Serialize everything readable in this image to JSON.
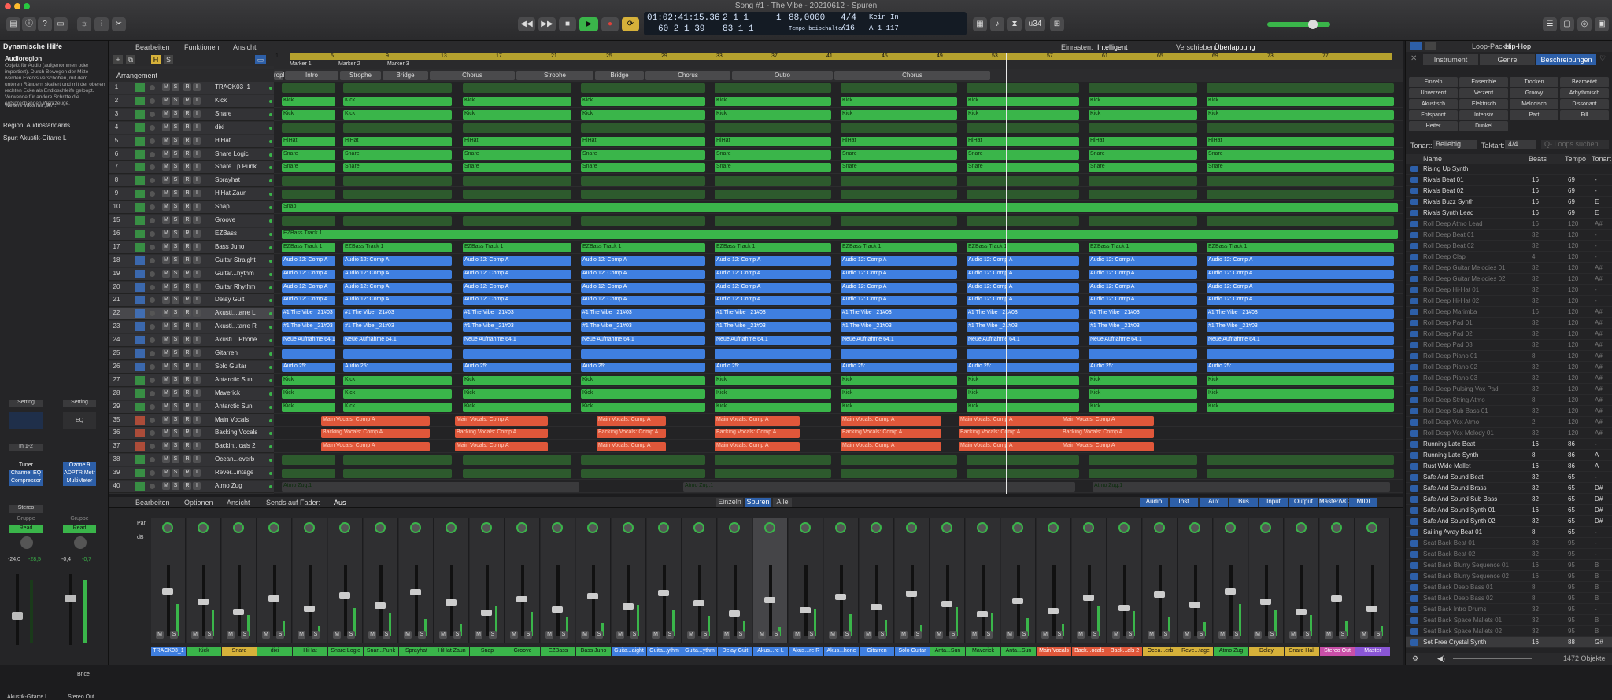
{
  "window": {
    "title": "Song #1 - The Vibe - 20210612 - Spuren"
  },
  "lcd": {
    "position": "01:02:41:15.36",
    "bars": "2  1  1",
    "subpos": "60  2  1  39",
    "bars2": "83  1  1",
    "beat": "1",
    "tempo": "88,0000",
    "tempo_label": "Tempo beibehalten",
    "sig": "4/4",
    "sig2": "/16",
    "key_in": "Kein In",
    "key_out": "A  1  117"
  },
  "toolbar": {
    "cpu_label": "u34"
  },
  "inspector": {
    "help_title": "Dynamische Hilfe",
    "help_heading": "Audioregion",
    "help_text": "Objekt für Audio (aufgenommen oder importiert). Durch Bewegen der Mitte werden Events verschoben, mit dem unteren Rändern skaliert und mit der oberen rechten Ecke als Endloschleife geloopt. Verwende für andere Schritte die entsprechenden Werkzeuge.",
    "help_more": "Weitere Infos mit „⌘/\".",
    "region_label": "Region: Audiostandards",
    "track_label": "Spur: Akustik-Gitarre L",
    "strip1": {
      "setting": "Setting",
      "input": "In 1-2",
      "plugins": [
        "Tuner",
        "Channel EQ",
        "Compressor"
      ],
      "stereo": "Stereo",
      "group": "Gruppe",
      "read": "Read",
      "gain": "-24,0",
      "peak": "-28,5",
      "name": "Akustik-Gitarre L"
    },
    "strip2": {
      "setting": "Setting",
      "eq": "EQ",
      "plugins": [
        "Ozone 9",
        "ADPTR Metr",
        "MultiMeter"
      ],
      "group": "Gruppe",
      "read": "Read",
      "gain": "-0,4",
      "peak": "-0,7",
      "name": "Stereo Out",
      "bnce": "Bnce"
    }
  },
  "arrange": {
    "menus": [
      "Bearbeiten",
      "Funktionen",
      "Ansicht"
    ],
    "snap_label": "Einrasten:",
    "snap_value": "Intelligent",
    "drag_label": "Verschieben:",
    "drag_value": "Überlappung",
    "arrangement_label": "Arrangement",
    "ruler": [
      "1",
      "5",
      "9",
      "13",
      "17",
      "21",
      "25",
      "29",
      "33",
      "37",
      "41",
      "45",
      "49",
      "53",
      "57",
      "61",
      "65",
      "69",
      "73",
      "77"
    ],
    "markers": [
      "Marker 1",
      "Marker 2",
      "Marker 3"
    ],
    "sections": [
      "ropl",
      "Intro",
      "Strophe",
      "Bridge",
      "Chorus",
      "Strophe",
      "Bridge",
      "Chorus",
      "Outro",
      "Chorus"
    ],
    "tracks": [
      {
        "num": "1",
        "name": "TRACK03_1"
      },
      {
        "num": "2",
        "name": "Kick"
      },
      {
        "num": "3",
        "name": "Snare"
      },
      {
        "num": "4",
        "name": "dixi"
      },
      {
        "num": "5",
        "name": "HiHat"
      },
      {
        "num": "6",
        "name": "Snare Logic"
      },
      {
        "num": "7",
        "name": "Snare...p Punk"
      },
      {
        "num": "8",
        "name": "Sprayhat"
      },
      {
        "num": "9",
        "name": "HiHat Zaun"
      },
      {
        "num": "10",
        "name": "Snap"
      },
      {
        "num": "15",
        "name": "Groove"
      },
      {
        "num": "16",
        "name": "EZBass"
      },
      {
        "num": "17",
        "name": "Bass Juno"
      },
      {
        "num": "18",
        "name": "Guitar Straight"
      },
      {
        "num": "19",
        "name": "Guitar...hythm"
      },
      {
        "num": "20",
        "name": "Guitar Rhythm"
      },
      {
        "num": "21",
        "name": "Delay Guit"
      },
      {
        "num": "22",
        "name": "Akusti...tarre L"
      },
      {
        "num": "23",
        "name": "Akusti...tarre R"
      },
      {
        "num": "24",
        "name": "Akusti...iPhone"
      },
      {
        "num": "25",
        "name": "Gitarren"
      },
      {
        "num": "26",
        "name": "Solo Guitar"
      },
      {
        "num": "27",
        "name": "Antarctic Sun"
      },
      {
        "num": "28",
        "name": "Maverick"
      },
      {
        "num": "29",
        "name": "Antarctic Sun"
      },
      {
        "num": "35",
        "name": "Main Vocals"
      },
      {
        "num": "36",
        "name": "Backing Vocals"
      },
      {
        "num": "37",
        "name": "Backin...cals 2"
      },
      {
        "num": "38",
        "name": "Ocean...everb"
      },
      {
        "num": "39",
        "name": "Rever...intage"
      },
      {
        "num": "40",
        "name": "Atmo Zug"
      }
    ],
    "region_labels": {
      "kick": "Kick",
      "hihat": "HiHat",
      "snare": "Snare",
      "snap": "Snap",
      "ezbass": "EZBass Track 1",
      "comp": "Audio 12: Comp A",
      "vibe": "#1 The Vibe _21#03",
      "neue": "Neue Aufnahme 64,1",
      "solo": "Audio 25:",
      "main": "Main Vocals: Comp A",
      "backing": "Backing Vocals: Comp A",
      "atmo": "Atmo Zug.1"
    }
  },
  "mixer": {
    "menus": [
      "Bearbeiten",
      "Optionen",
      "Ansicht"
    ],
    "sends_label": "Sends auf Fader:",
    "sends_value": "Aus",
    "views": [
      "Einzeln",
      "Spuren",
      "Alle"
    ],
    "filters": [
      "Audio",
      "Inst",
      "Aux",
      "Bus",
      "Input",
      "Output",
      "Master/VCA",
      "MIDI"
    ],
    "pan_label": "Pan",
    "db_label": "dB",
    "channels": [
      {
        "name": "TRACK03_1",
        "color": "#3f7fe0"
      },
      {
        "name": "Kick",
        "color": "#3ab54a"
      },
      {
        "name": "Snare",
        "color": "#d6b13a"
      },
      {
        "name": "dixi",
        "color": "#3ab54a"
      },
      {
        "name": "HiHat",
        "color": "#3ab54a"
      },
      {
        "name": "Snare Logic",
        "color": "#3ab54a"
      },
      {
        "name": "Snar...Punk",
        "color": "#3ab54a"
      },
      {
        "name": "Sprayhat",
        "color": "#3ab54a"
      },
      {
        "name": "HiHat Zaun",
        "color": "#3ab54a"
      },
      {
        "name": "Snap",
        "color": "#3ab54a"
      },
      {
        "name": "Groove",
        "color": "#3ab54a"
      },
      {
        "name": "EZBass",
        "color": "#3ab54a"
      },
      {
        "name": "Bass Juno",
        "color": "#3ab54a"
      },
      {
        "name": "Guita...aight",
        "color": "#3f7fe0"
      },
      {
        "name": "Guita...ythm",
        "color": "#3f7fe0"
      },
      {
        "name": "Guita...ythm",
        "color": "#3f7fe0"
      },
      {
        "name": "Delay Guit",
        "color": "#3f7fe0"
      },
      {
        "name": "Akus...re L",
        "color": "#3f7fe0"
      },
      {
        "name": "Akus...re R",
        "color": "#3f7fe0"
      },
      {
        "name": "Akus...hone",
        "color": "#3f7fe0"
      },
      {
        "name": "Gitarren",
        "color": "#3f7fe0"
      },
      {
        "name": "Solo Guitar",
        "color": "#3f7fe0"
      },
      {
        "name": "Anta...Sun",
        "color": "#3ab54a"
      },
      {
        "name": "Maverick",
        "color": "#3ab54a"
      },
      {
        "name": "Anta...Sun",
        "color": "#3ab54a"
      },
      {
        "name": "Main Vocals",
        "color": "#e0573a"
      },
      {
        "name": "Back...ocals",
        "color": "#e0573a"
      },
      {
        "name": "Back...als 2",
        "color": "#e0573a"
      },
      {
        "name": "Ocea...erb",
        "color": "#d6b13a"
      },
      {
        "name": "Reve...tage",
        "color": "#d6b13a"
      },
      {
        "name": "Atmo Zug",
        "color": "#3ab54a"
      },
      {
        "name": "Delay",
        "color": "#d6b13a"
      },
      {
        "name": "Snare Hall",
        "color": "#d6b13a"
      },
      {
        "name": "Stereo Out",
        "color": "#c94fa8"
      },
      {
        "name": "Master",
        "color": "#8a56d6"
      }
    ]
  },
  "browser": {
    "title": "Loop-Packs:",
    "pack": "Hip-Hop",
    "tabs": [
      "Instrument",
      "Genre",
      "Beschreibungen"
    ],
    "keywords": [
      "Einzeln",
      "Ensemble",
      "Trocken",
      "Bearbeitet",
      "Unverzerrt",
      "Verzerrt",
      "Groovy",
      "Arhythmisch",
      "Akustisch",
      "Elektrisch",
      "Melodisch",
      "Dissonant",
      "Entspannt",
      "Intensiv",
      "Part",
      "Fill",
      "Heiter",
      "Dunkel"
    ],
    "key_label": "Tonart:",
    "key_value": "Beliebig",
    "time_label": "Taktart:",
    "time_value": "4/4",
    "search_placeholder": "Q- Loops suchen",
    "columns": [
      "Name",
      "Beats",
      "Tempo",
      "Tonart"
    ],
    "loops": [
      {
        "name": "Rising Up Synth",
        "beats": "",
        "tempo": "",
        "key": ""
      },
      {
        "name": "Rivals Beat 01",
        "beats": "16",
        "tempo": "69",
        "key": "-"
      },
      {
        "name": "Rivals Beat 02",
        "beats": "16",
        "tempo": "69",
        "key": "-"
      },
      {
        "name": "Rivals Buzz Synth",
        "beats": "16",
        "tempo": "69",
        "key": "E"
      },
      {
        "name": "Rivals Synth Lead",
        "beats": "16",
        "tempo": "69",
        "key": "E"
      },
      {
        "name": "Roll Deep Atmo Lead",
        "beats": "16",
        "tempo": "120",
        "key": "A#"
      },
      {
        "name": "Roll Deep Beat 01",
        "beats": "32",
        "tempo": "120",
        "key": "-"
      },
      {
        "name": "Roll Deep Beat 02",
        "beats": "32",
        "tempo": "120",
        "key": "-"
      },
      {
        "name": "Roll Deep Clap",
        "beats": "4",
        "tempo": "120",
        "key": "-"
      },
      {
        "name": "Roll Deep Guitar Melodies 01",
        "beats": "32",
        "tempo": "120",
        "key": "A#"
      },
      {
        "name": "Roll Deep Guitar Melodies 02",
        "beats": "32",
        "tempo": "120",
        "key": "A#"
      },
      {
        "name": "Roll Deep Hi-Hat 01",
        "beats": "32",
        "tempo": "120",
        "key": "-"
      },
      {
        "name": "Roll Deep Hi-Hat 02",
        "beats": "32",
        "tempo": "120",
        "key": "-"
      },
      {
        "name": "Roll Deep Marimba",
        "beats": "16",
        "tempo": "120",
        "key": "A#"
      },
      {
        "name": "Roll Deep Pad 01",
        "beats": "32",
        "tempo": "120",
        "key": "A#"
      },
      {
        "name": "Roll Deep Pad 02",
        "beats": "32",
        "tempo": "120",
        "key": "A#"
      },
      {
        "name": "Roll Deep Pad 03",
        "beats": "32",
        "tempo": "120",
        "key": "A#"
      },
      {
        "name": "Roll Deep Piano 01",
        "beats": "8",
        "tempo": "120",
        "key": "A#"
      },
      {
        "name": "Roll Deep Piano 02",
        "beats": "32",
        "tempo": "120",
        "key": "A#"
      },
      {
        "name": "Roll Deep Piano 03",
        "beats": "32",
        "tempo": "120",
        "key": "A#"
      },
      {
        "name": "Roll Deep Pulsing Vox Pad",
        "beats": "32",
        "tempo": "120",
        "key": "A#"
      },
      {
        "name": "Roll Deep String Atmo",
        "beats": "8",
        "tempo": "120",
        "key": "A#"
      },
      {
        "name": "Roll Deep Sub Bass 01",
        "beats": "32",
        "tempo": "120",
        "key": "A#"
      },
      {
        "name": "Roll Deep Vox Atmo",
        "beats": "2",
        "tempo": "120",
        "key": "A#"
      },
      {
        "name": "Roll Deep Vox Melody 01",
        "beats": "32",
        "tempo": "120",
        "key": "A#"
      },
      {
        "name": "Running Late Beat",
        "beats": "16",
        "tempo": "86",
        "key": "-"
      },
      {
        "name": "Running Late Synth",
        "beats": "8",
        "tempo": "86",
        "key": "A"
      },
      {
        "name": "Rust Wide Mallet",
        "beats": "16",
        "tempo": "86",
        "key": "A"
      },
      {
        "name": "Safe And Sound Beat",
        "beats": "32",
        "tempo": "65",
        "key": "-"
      },
      {
        "name": "Safe And Sound Brass",
        "beats": "32",
        "tempo": "65",
        "key": "D#"
      },
      {
        "name": "Safe And Sound Sub Bass",
        "beats": "32",
        "tempo": "65",
        "key": "D#"
      },
      {
        "name": "Safe And Sound Synth 01",
        "beats": "16",
        "tempo": "65",
        "key": "D#"
      },
      {
        "name": "Safe And Sound Synth 02",
        "beats": "32",
        "tempo": "65",
        "key": "D#"
      },
      {
        "name": "Sailing Away Beat 01",
        "beats": "8",
        "tempo": "65",
        "key": "-"
      },
      {
        "name": "Seat Back Beat 01",
        "beats": "32",
        "tempo": "95",
        "key": "-"
      },
      {
        "name": "Seat Back Beat 02",
        "beats": "32",
        "tempo": "95",
        "key": "-"
      },
      {
        "name": "Seat Back Blurry Sequence 01",
        "beats": "16",
        "tempo": "95",
        "key": "B"
      },
      {
        "name": "Seat Back Blurry Sequence 02",
        "beats": "16",
        "tempo": "95",
        "key": "B"
      },
      {
        "name": "Seat Back Deep Bass 01",
        "beats": "8",
        "tempo": "95",
        "key": "B"
      },
      {
        "name": "Seat Back Deep Bass 02",
        "beats": "8",
        "tempo": "95",
        "key": "B"
      },
      {
        "name": "Seat Back Intro Drums",
        "beats": "32",
        "tempo": "95",
        "key": "-"
      },
      {
        "name": "Seat Back Space Mallets 01",
        "beats": "32",
        "tempo": "95",
        "key": "B"
      },
      {
        "name": "Seat Back Space Mallets 02",
        "beats": "32",
        "tempo": "95",
        "key": "B"
      },
      {
        "name": "Set Free Crystal Synth",
        "beats": "16",
        "tempo": "88",
        "key": "G#"
      }
    ],
    "count": "1472 Objekte"
  }
}
